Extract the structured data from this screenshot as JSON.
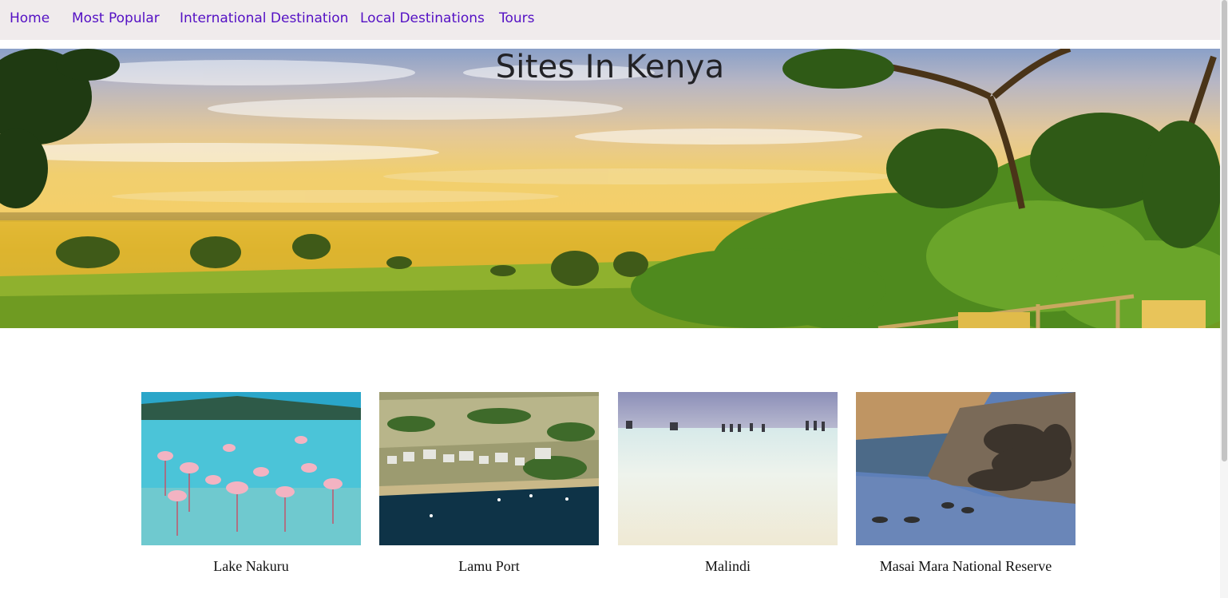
{
  "nav": {
    "items": [
      {
        "label": "Home"
      },
      {
        "label": "Most Popular"
      },
      {
        "label": "International Destination"
      },
      {
        "label": "Local Destinations"
      },
      {
        "label": "Tours"
      }
    ],
    "link_color": "#5410c4",
    "background": "#f0ebec"
  },
  "hero": {
    "title": "Sites In Kenya",
    "image": "savanna-landscape"
  },
  "gallery": {
    "cards": [
      {
        "caption": "Lake Nakuru",
        "image": "flamingos-lake"
      },
      {
        "caption": "Lamu Port",
        "image": "coastal-town-harbor"
      },
      {
        "caption": "Malindi",
        "image": "white-sand-beach"
      },
      {
        "caption": "Masai Mara National Reserve",
        "image": "wildebeest-river-crossing"
      }
    ]
  }
}
